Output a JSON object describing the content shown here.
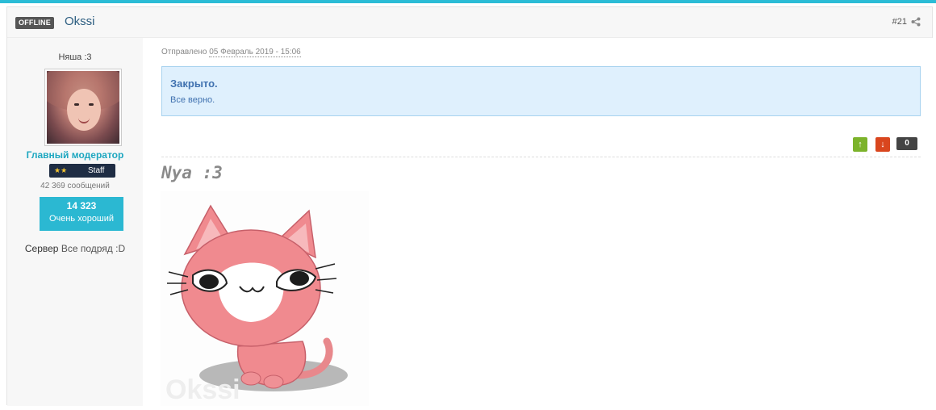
{
  "post": {
    "status_badge": "OFFLINE",
    "author": "Okssi",
    "number": "#21"
  },
  "sidebar": {
    "user_title": "Няша :3",
    "rank": "Главный модератор",
    "badge_stars": "★★",
    "badge_label": "Staff",
    "message_count": "42 369 сообщений",
    "reputation": {
      "value": "14 323",
      "label": "Очень хороший"
    },
    "server_label": "Сервер",
    "server_value": "Все подряд :D"
  },
  "content": {
    "sent_prefix": "Отправлено",
    "sent_date": "05 Февраль 2019 - 15:06",
    "notice": {
      "title": "Закрыто.",
      "text": "Все верно."
    },
    "votes": {
      "up": "↑",
      "down": "↓",
      "count": "0"
    },
    "body_text": "Nya :3",
    "image_watermark": "Okssi"
  },
  "colors": {
    "accent": "#2bbcd6",
    "rank_color": "#1ea7c0",
    "vote_up": "#7cb32b",
    "vote_down": "#d9461e",
    "notice_bg": "#dff0fd"
  }
}
